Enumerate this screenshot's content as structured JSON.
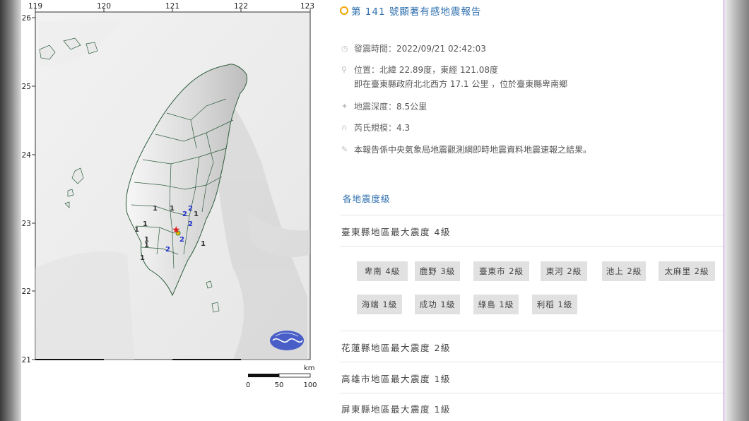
{
  "map": {
    "lon_ticks": [
      "119",
      "120",
      "121",
      "122",
      "123"
    ],
    "lat_ticks": [
      "26",
      "25",
      "24",
      "23",
      "22",
      "21"
    ],
    "scale_unit": "km",
    "scale_labels": [
      "0",
      "50",
      "100"
    ],
    "intensity_marks": [
      {
        "value": "1",
        "color": "#333333"
      },
      {
        "value": "1",
        "color": "#333333"
      },
      {
        "value": "2",
        "color": "#2233cc"
      },
      {
        "value": "2",
        "color": "#2233cc"
      },
      {
        "value": "1",
        "color": "#333333"
      },
      {
        "value": "1",
        "color": "#333333"
      },
      {
        "value": "2",
        "color": "#2233cc"
      },
      {
        "value": "1",
        "color": "#333333"
      },
      {
        "value": "1",
        "color": "#333333"
      },
      {
        "value": "1",
        "color": "#333333"
      },
      {
        "value": "2",
        "color": "#2233cc"
      },
      {
        "value": "2",
        "color": "#2233cc"
      },
      {
        "value": "1",
        "color": "#333333"
      },
      {
        "value": "1",
        "color": "#333333"
      }
    ]
  },
  "report": {
    "title": "第 141 號顯著有感地震報告",
    "time_label": "發震時間：",
    "time_value": "2022/09/21 02:42:03",
    "location_label": "位置：",
    "location_value": "北緯 22.89度，東經 121.08度",
    "location_detail": "即在臺東縣政府北北西方 17.1 公里 ，位於臺東縣卑南鄉",
    "depth_label": "地震深度：",
    "depth_value": "8.5公里",
    "magnitude_label": "芮氏規模：",
    "magnitude_value": "4.3",
    "note": "本報告係中央氣象局地震觀測網即時地震資料地震速報之結果。",
    "section_title": "各地震度級"
  },
  "regions": [
    {
      "title": "臺東縣地區最大震度 4級",
      "stations": [
        "卑南 4級",
        "鹿野 3級",
        "臺東市 2級",
        "東河 2級",
        "池上 2級",
        "太麻里 2級",
        "海端 1級",
        "成功 1級",
        "綠島 1級",
        "利稻 1級"
      ]
    },
    {
      "title": "花蓮縣地區最大震度 2級"
    },
    {
      "title": "高雄市地區最大震度 1級"
    },
    {
      "title": "屏東縣地區最大震度 1級"
    }
  ],
  "colors": {
    "accent_blue": "#2f6fae",
    "title_icon": "#f0a500",
    "epicenter": "#e02020",
    "station_bg": "#e1e1e1"
  }
}
